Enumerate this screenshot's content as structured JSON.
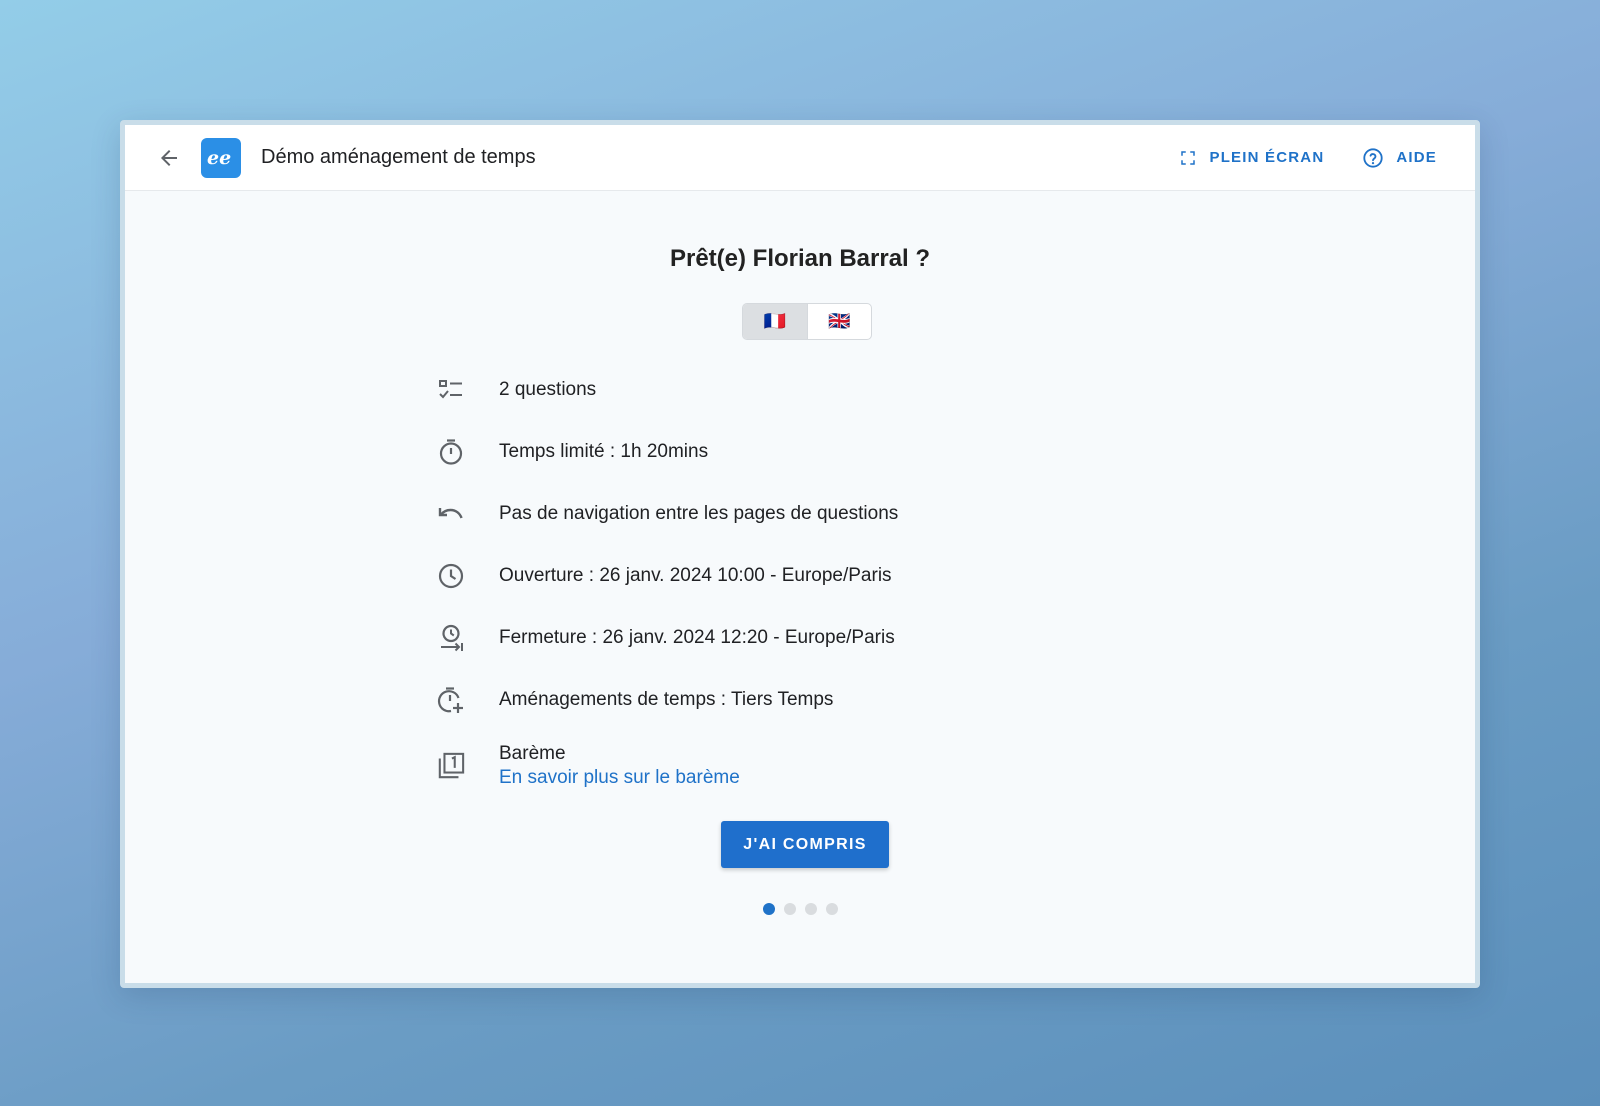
{
  "header": {
    "title": "Démo aménagement de temps",
    "fullscreen_label": "PLEIN ÉCRAN",
    "help_label": "AIDE"
  },
  "main": {
    "heading": "Prêt(e) Florian Barral ?",
    "languages": [
      {
        "flag": "🇫🇷",
        "selected": true
      },
      {
        "flag": "🇬🇧",
        "selected": false
      }
    ],
    "info": {
      "questions": "2 questions",
      "time_limit": "Temps limité : 1h 20mins",
      "navigation": "Pas de navigation entre les pages de questions",
      "opening": "Ouverture : 26 janv. 2024 10:00 - Europe/Paris",
      "closing": "Fermeture : 26 janv. 2024 12:20 - Europe/Paris",
      "accommodation": "Aménagements de temps : Tiers Temps",
      "grading": "Barème",
      "grading_link": "En savoir plus sur le barème"
    },
    "confirm_label": "J'AI COMPRIS",
    "steps_total": 4,
    "steps_current": 1
  },
  "colors": {
    "accent": "#1f72c8",
    "logo": "#2b8fe6"
  }
}
